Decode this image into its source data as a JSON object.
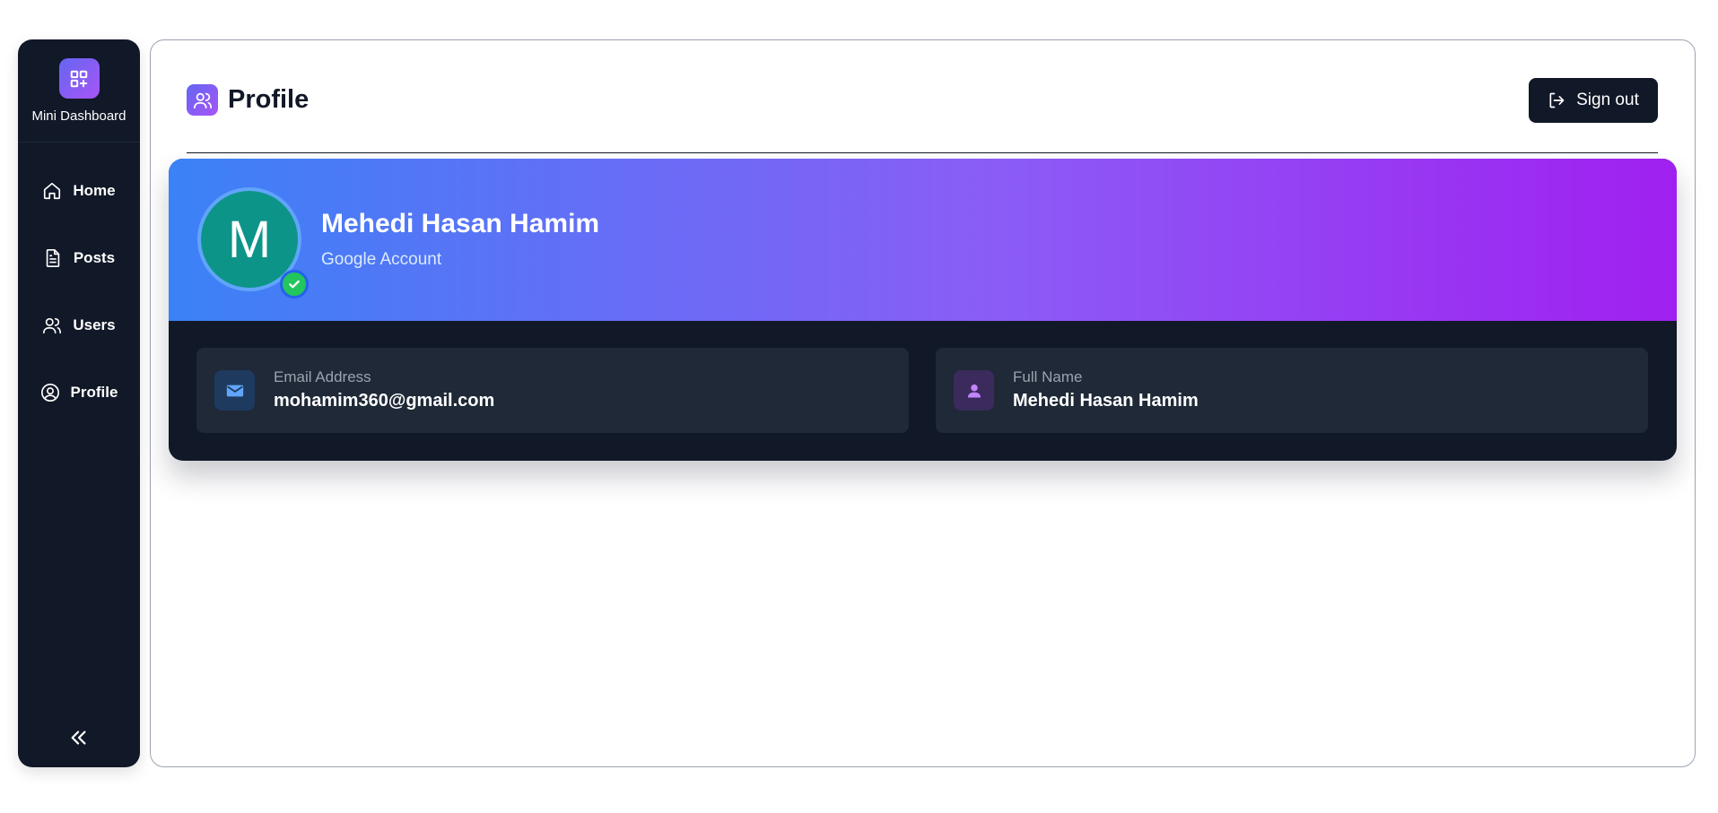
{
  "sidebar": {
    "brand": "Mini Dashboard",
    "items": [
      {
        "label": "Home",
        "icon": "home-icon"
      },
      {
        "label": "Posts",
        "icon": "document-icon"
      },
      {
        "label": "Users",
        "icon": "users-icon"
      },
      {
        "label": "Profile",
        "icon": "user-circle-icon"
      }
    ],
    "collapse_icon": "chevrons-left-icon"
  },
  "header": {
    "title": "Profile",
    "signout_label": "Sign out"
  },
  "profile": {
    "initial": "M",
    "name": "Mehedi Hasan Hamim",
    "account_type": "Google Account",
    "email_label": "Email Address",
    "email": "mohamim360@gmail.com",
    "fullname_label": "Full Name",
    "fullname": "Mehedi Hasan Hamim"
  },
  "colors": {
    "sidebar_bg": "#111827",
    "accent_start": "#3b82f6",
    "accent_end": "#a020f0",
    "avatar_bg": "#0d9488",
    "verified": "#22c55e"
  }
}
